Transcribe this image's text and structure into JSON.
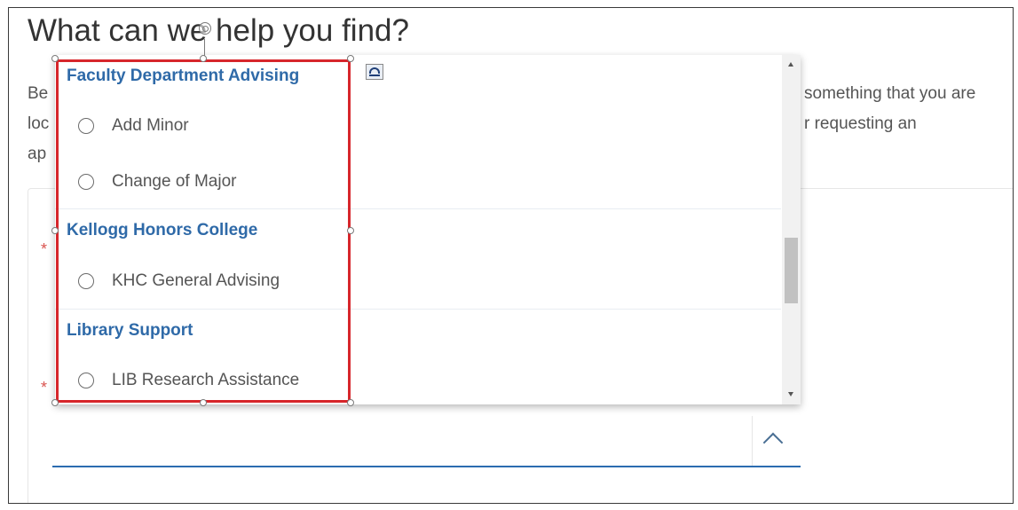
{
  "page": {
    "title": "What can we help you find?",
    "intro_left": [
      "Be",
      "loc",
      "ap"
    ],
    "intro_right": [
      "something that you are",
      "r requesting an"
    ],
    "required_marker": "*"
  },
  "dropdown": {
    "groups": [
      {
        "header": "Faculty Department Advising",
        "options": [
          "Add Minor",
          "Change of Major"
        ]
      },
      {
        "header": "Kellogg Honors College",
        "options": [
          "KHC General Advising"
        ]
      },
      {
        "header": "Library Support",
        "options": [
          "LIB Research Assistance"
        ]
      }
    ],
    "scroll_position_fraction": 0.55
  },
  "icons": {
    "rotate": "rotate-handle-icon",
    "layout": "layout-options-icon",
    "chevron": "chevron-up-icon",
    "radio": "radio-icon"
  },
  "colors": {
    "group_header": "#2f6aa8",
    "selection_border": "#d7262b",
    "field_underline": "#2b6cb0",
    "required": "#d9534f"
  }
}
